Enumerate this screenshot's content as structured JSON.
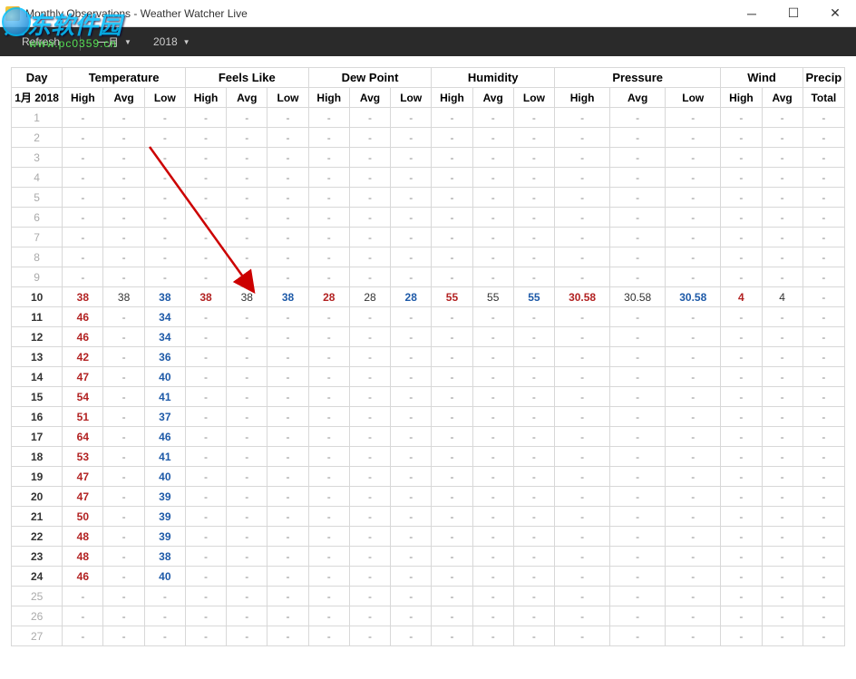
{
  "window": {
    "title": "Monthly Observations - Weather Watcher Live"
  },
  "toolbar": {
    "refresh": "Refresh",
    "month": "一月",
    "year": "2018"
  },
  "watermark": {
    "text": "河东软件园",
    "url": "www.pc0359.cn"
  },
  "headers": {
    "day": "Day",
    "groups": [
      "Temperature",
      "Feels Like",
      "Dew Point",
      "Humidity",
      "Pressure",
      "Wind",
      "Precip"
    ],
    "monthYear": "1月 2018",
    "hal": [
      "High",
      "Avg",
      "Low"
    ],
    "windSubs": [
      "High",
      "Avg"
    ],
    "precipSub": "Total"
  },
  "days": [
    {
      "d": "1"
    },
    {
      "d": "2"
    },
    {
      "d": "3"
    },
    {
      "d": "4"
    },
    {
      "d": "5"
    },
    {
      "d": "6"
    },
    {
      "d": "7"
    },
    {
      "d": "8"
    },
    {
      "d": "9"
    },
    {
      "d": "10",
      "has": true,
      "temp": [
        "38",
        "38",
        "38"
      ],
      "feels": [
        "38",
        "38",
        "38"
      ],
      "dew": [
        "28",
        "28",
        "28"
      ],
      "hum": [
        "55",
        "55",
        "55"
      ],
      "pres": [
        "30.58",
        "30.58",
        "30.58"
      ],
      "wind": [
        "4",
        "4"
      ]
    },
    {
      "d": "11",
      "has": true,
      "temp": [
        "46",
        "-",
        "34"
      ]
    },
    {
      "d": "12",
      "has": true,
      "temp": [
        "46",
        "-",
        "34"
      ]
    },
    {
      "d": "13",
      "has": true,
      "temp": [
        "42",
        "-",
        "36"
      ]
    },
    {
      "d": "14",
      "has": true,
      "temp": [
        "47",
        "-",
        "40"
      ]
    },
    {
      "d": "15",
      "has": true,
      "temp": [
        "54",
        "-",
        "41"
      ]
    },
    {
      "d": "16",
      "has": true,
      "temp": [
        "51",
        "-",
        "37"
      ]
    },
    {
      "d": "17",
      "has": true,
      "temp": [
        "64",
        "-",
        "46"
      ]
    },
    {
      "d": "18",
      "has": true,
      "temp": [
        "53",
        "-",
        "41"
      ]
    },
    {
      "d": "19",
      "has": true,
      "temp": [
        "47",
        "-",
        "40"
      ]
    },
    {
      "d": "20",
      "has": true,
      "temp": [
        "47",
        "-",
        "39"
      ]
    },
    {
      "d": "21",
      "has": true,
      "temp": [
        "50",
        "-",
        "39"
      ]
    },
    {
      "d": "22",
      "has": true,
      "temp": [
        "48",
        "-",
        "39"
      ]
    },
    {
      "d": "23",
      "has": true,
      "temp": [
        "48",
        "-",
        "38"
      ]
    },
    {
      "d": "24",
      "has": true,
      "temp": [
        "46",
        "-",
        "40"
      ]
    },
    {
      "d": "25"
    },
    {
      "d": "26"
    },
    {
      "d": "27"
    }
  ]
}
